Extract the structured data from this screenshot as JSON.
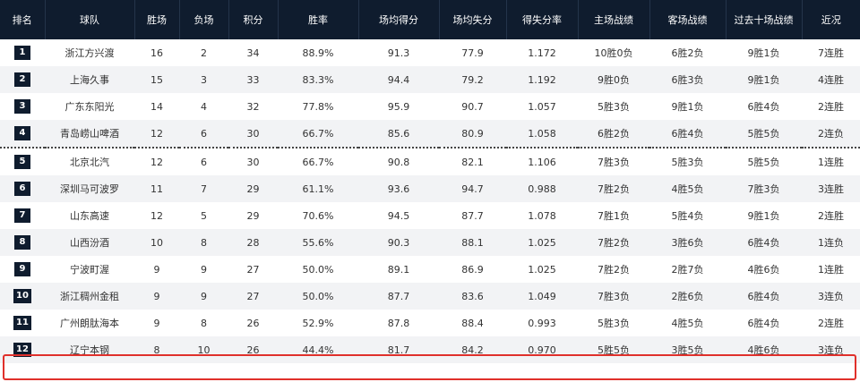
{
  "headers": [
    "排名",
    "球队",
    "胜场",
    "负场",
    "积分",
    "胜率",
    "场均得分",
    "场均失分",
    "得失分率",
    "主场战绩",
    "客场战绩",
    "过去十场战绩",
    "近况"
  ],
  "rows": [
    {
      "rank": "1",
      "team": "浙江方兴渡",
      "wins": "16",
      "losses": "2",
      "points": "34",
      "win_pct": "88.9%",
      "ppg": "91.3",
      "opp_ppg": "77.9",
      "ratio": "1.172",
      "home": "10胜0负",
      "away": "6胜2负",
      "last10": "9胜1负",
      "streak": "7连胜"
    },
    {
      "rank": "2",
      "team": "上海久事",
      "wins": "15",
      "losses": "3",
      "points": "33",
      "win_pct": "83.3%",
      "ppg": "94.4",
      "opp_ppg": "79.2",
      "ratio": "1.192",
      "home": "9胜0负",
      "away": "6胜3负",
      "last10": "9胜1负",
      "streak": "4连胜"
    },
    {
      "rank": "3",
      "team": "广东东阳光",
      "wins": "14",
      "losses": "4",
      "points": "32",
      "win_pct": "77.8%",
      "ppg": "95.9",
      "opp_ppg": "90.7",
      "ratio": "1.057",
      "home": "5胜3负",
      "away": "9胜1负",
      "last10": "6胜4负",
      "streak": "2连胜"
    },
    {
      "rank": "4",
      "team": "青岛崂山啤酒",
      "wins": "12",
      "losses": "6",
      "points": "30",
      "win_pct": "66.7%",
      "ppg": "85.6",
      "opp_ppg": "80.9",
      "ratio": "1.058",
      "home": "6胜2负",
      "away": "6胜4负",
      "last10": "5胜5负",
      "streak": "2连负"
    },
    {
      "rank": "5",
      "team": "北京北汽",
      "wins": "12",
      "losses": "6",
      "points": "30",
      "win_pct": "66.7%",
      "ppg": "90.8",
      "opp_ppg": "82.1",
      "ratio": "1.106",
      "home": "7胜3负",
      "away": "5胜3负",
      "last10": "5胜5负",
      "streak": "1连胜"
    },
    {
      "rank": "6",
      "team": "深圳马可波罗",
      "wins": "11",
      "losses": "7",
      "points": "29",
      "win_pct": "61.1%",
      "ppg": "93.6",
      "opp_ppg": "94.7",
      "ratio": "0.988",
      "home": "7胜2负",
      "away": "4胜5负",
      "last10": "7胜3负",
      "streak": "3连胜"
    },
    {
      "rank": "7",
      "team": "山东高速",
      "wins": "12",
      "losses": "5",
      "points": "29",
      "win_pct": "70.6%",
      "ppg": "94.5",
      "opp_ppg": "87.7",
      "ratio": "1.078",
      "home": "7胜1负",
      "away": "5胜4负",
      "last10": "9胜1负",
      "streak": "2连胜"
    },
    {
      "rank": "8",
      "team": "山西汾酒",
      "wins": "10",
      "losses": "8",
      "points": "28",
      "win_pct": "55.6%",
      "ppg": "90.3",
      "opp_ppg": "88.1",
      "ratio": "1.025",
      "home": "7胜2负",
      "away": "3胜6负",
      "last10": "6胜4负",
      "streak": "1连负"
    },
    {
      "rank": "9",
      "team": "宁波町渥",
      "wins": "9",
      "losses": "9",
      "points": "27",
      "win_pct": "50.0%",
      "ppg": "89.1",
      "opp_ppg": "86.9",
      "ratio": "1.025",
      "home": "7胜2负",
      "away": "2胜7负",
      "last10": "4胜6负",
      "streak": "1连胜"
    },
    {
      "rank": "10",
      "team": "浙江稠州金租",
      "wins": "9",
      "losses": "9",
      "points": "27",
      "win_pct": "50.0%",
      "ppg": "87.7",
      "opp_ppg": "83.6",
      "ratio": "1.049",
      "home": "7胜3负",
      "away": "2胜6负",
      "last10": "6胜4负",
      "streak": "3连负"
    },
    {
      "rank": "11",
      "team": "广州朗肽海本",
      "wins": "9",
      "losses": "8",
      "points": "26",
      "win_pct": "52.9%",
      "ppg": "87.8",
      "opp_ppg": "88.4",
      "ratio": "0.993",
      "home": "5胜3负",
      "away": "4胜5负",
      "last10": "6胜4负",
      "streak": "2连胜"
    },
    {
      "rank": "12",
      "team": "辽宁本钢",
      "wins": "8",
      "losses": "10",
      "points": "26",
      "win_pct": "44.4%",
      "ppg": "81.7",
      "opp_ppg": "84.2",
      "ratio": "0.970",
      "home": "5胜5负",
      "away": "3胜5负",
      "last10": "4胜6负",
      "streak": "3连负"
    }
  ],
  "colors": {
    "header_bg": "#0f1c2e",
    "highlight_border": "#e0302b",
    "zebra": "#f2f3f5"
  }
}
